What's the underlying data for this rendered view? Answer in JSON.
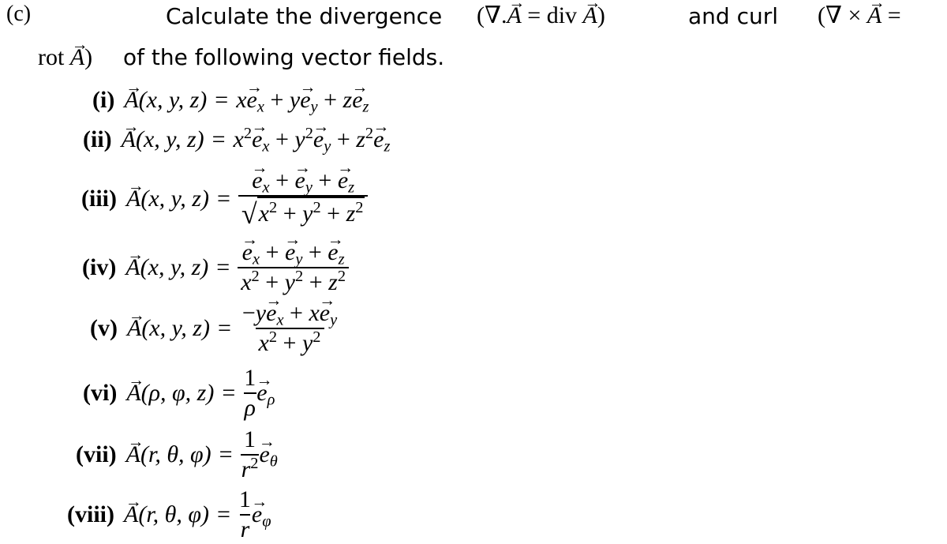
{
  "header": {
    "part_label": "(c)",
    "intro_text": "Calculate the divergence",
    "div_expr": {
      "open": "(∇.",
      "A": "A",
      "eq": "=",
      "div": "div",
      "close": ")"
    },
    "and_curl_text": "and curl",
    "curl_expr": {
      "open": "(∇ ×",
      "A": "A",
      "eq": "="
    },
    "rot_expr": {
      "rot": "rot",
      "A": "A",
      "close": ")"
    },
    "following_text": "of the following vector fields."
  },
  "equations": [
    {
      "label": "(i)",
      "lhs": "A",
      "args": "(x, y, z)",
      "rhs": "x e_x + y e_y + z e_z"
    },
    {
      "label": "(ii)",
      "lhs": "A",
      "args": "(x, y, z)",
      "rhs": "x² e_x + y² e_y + z² e_z"
    },
    {
      "label": "(iii)",
      "lhs": "A",
      "args": "(x, y, z)",
      "numerator": "e_x + e_y + e_z",
      "denominator": "√(x² + y² + z²)"
    },
    {
      "label": "(iv)",
      "lhs": "A",
      "args": "(x, y, z)",
      "numerator": "e_x + e_y + e_z",
      "denominator": "x² + y² + z²"
    },
    {
      "label": "(v)",
      "lhs": "A",
      "args": "(x, y, z)",
      "numerator": "−y e_x + x e_y",
      "denominator": "x² + y²"
    },
    {
      "label": "(vi)",
      "lhs": "A",
      "args": "(ρ, φ, z)",
      "numerator": "1",
      "denominator": "ρ",
      "unit_vector": "e_ρ"
    },
    {
      "label": "(vii)",
      "lhs": "A",
      "args": "(r, θ, φ)",
      "numerator": "1",
      "denominator": "r²",
      "unit_vector": "e_θ"
    },
    {
      "label": "(viii)",
      "lhs": "A",
      "args": "(r, θ, φ)",
      "numerator": "1",
      "denominator": "r",
      "unit_vector": "e_φ"
    }
  ],
  "symbols": {
    "eq": "=",
    "plus": "+",
    "minus": "−",
    "e": "e",
    "A": "A",
    "x": "x",
    "y": "y",
    "z": "z",
    "rho": "ρ",
    "phi": "φ",
    "theta": "θ",
    "r": "r",
    "one": "1",
    "two": "2",
    "sqrt": "√",
    "args_xyz": "(x, y, z)",
    "args_rpz": "(ρ, φ, z)",
    "args_rtp": "(r, θ, φ)"
  }
}
